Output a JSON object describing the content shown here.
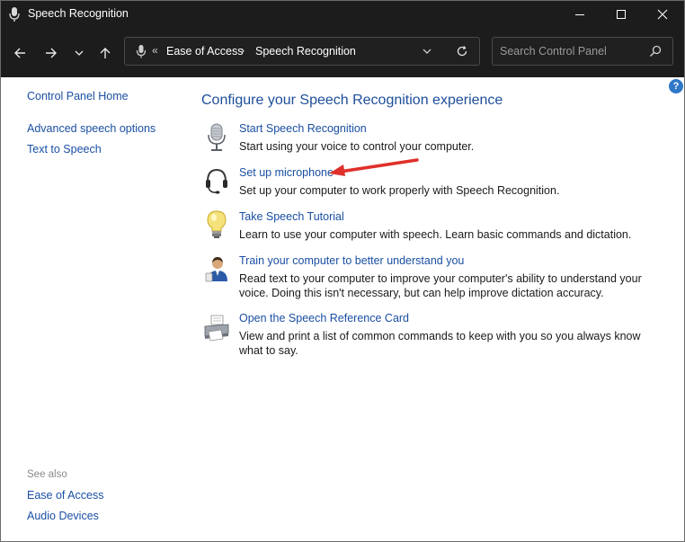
{
  "window": {
    "title": "Speech Recognition",
    "title_icon": "microphone-icon",
    "controls": [
      "minimize-icon",
      "maximize-icon",
      "close-icon"
    ]
  },
  "navigation": {
    "back_icon": "back-arrow-icon",
    "forward_icon": "forward-arrow-icon",
    "recent_icon": "chevron-down-icon",
    "up_icon": "up-arrow-icon"
  },
  "address": {
    "overflow": "«",
    "crumbs": [
      "Ease of Access",
      "Speech Recognition"
    ],
    "separator": "›"
  },
  "search": {
    "placeholder": "Search Control Panel"
  },
  "left_pane": {
    "home": "Control Panel Home",
    "links": [
      "Advanced speech options",
      "Text to Speech"
    ],
    "see_also_label": "See also",
    "see_also_links": [
      "Ease of Access",
      "Audio Devices"
    ]
  },
  "main": {
    "title": "Configure your Speech Recognition experience",
    "tasks": [
      {
        "link": "Start Speech Recognition",
        "desc": "Start using your voice to control your computer.",
        "icon": "microphone-icon"
      },
      {
        "link": "Set up microphone",
        "desc": "Set up your computer to work properly with Speech Recognition.",
        "icon": "headset-icon"
      },
      {
        "link": "Take Speech Tutorial",
        "desc": "Learn to use your computer with speech.  Learn basic commands and dictation.",
        "icon": "lightbulb-icon"
      },
      {
        "link": "Train your computer to better understand you",
        "desc": "Read text to your computer to improve your computer's ability to understand your voice.  Doing this isn't necessary, but can help improve dictation accuracy.",
        "icon": "user-training-icon"
      },
      {
        "link": "Open the Speech Reference Card",
        "desc": "View and print a list of common commands to keep with you so you always know what to say.",
        "icon": "printer-icon"
      }
    ]
  },
  "colors": {
    "titlebar": "#1c1c1c",
    "link": "#1a4fa3",
    "heading": "#1e4e9a",
    "annotation_arrow": "#e0302a"
  }
}
